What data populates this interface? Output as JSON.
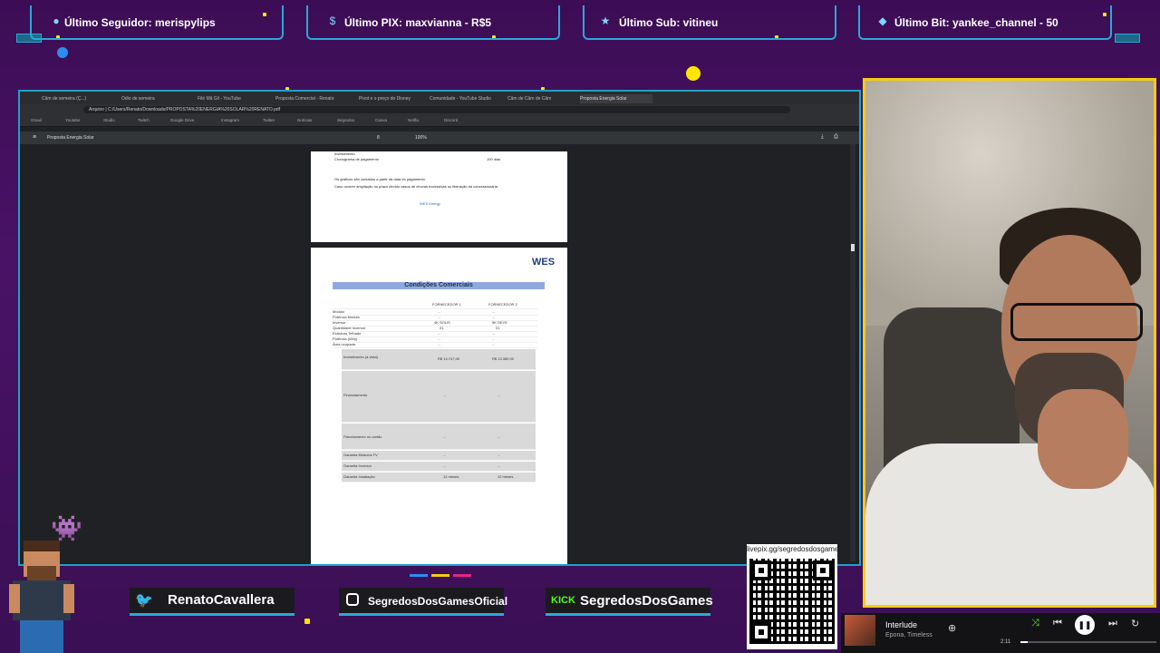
{
  "overlay": {
    "alerts": [
      {
        "label": "Último Seguidor: merispylips",
        "icon": "user-icon"
      },
      {
        "label": "Último PIX: maxvianna - R$5",
        "icon": "dollar-icon"
      },
      {
        "label": "Último Sub: vitineu",
        "icon": "star-icon"
      },
      {
        "label": "Último Bit: yankee_channel - 50",
        "icon": "diamond-icon"
      }
    ],
    "socials": {
      "twitter": "RenatoCavallera",
      "instagram": "SegredosDosGamesOficial",
      "kick_badge": "KICK",
      "kick": "SegredosDosGames"
    },
    "qr_url": "livepix.gg/segredosdosgames",
    "accent": "#2aa8d8",
    "cam_border": "#f4cc14"
  },
  "browser": {
    "tabs": [
      "Câm de semeira (Ç...)",
      "Odio de semeira",
      "Filé Mã Gil - YouTube",
      "Proposta Comercial - Renato",
      "Pivot e o preço do Disney",
      "Comunidade - YouTube Studio",
      "Câm de Câm de Câm",
      "Proposta Energia Solar"
    ],
    "address_label": "Arquivo",
    "address": "C:/Users/Renato/Downloads/PROPOSTA%20ENERGIA%20SOLAR%20RENATO.pdf",
    "bookmarks": [
      "Gmail",
      "Youtube",
      "Studio",
      "Twitch",
      "Google Drive",
      "Instagram",
      "Twitter",
      "Notícias",
      "Segredos",
      "Canva",
      "Netflix",
      "Discord"
    ],
    "pdf_title": "Proposta Energia Solar",
    "pdf_page": "8",
    "pdf_zoom": "100%"
  },
  "pdf": {
    "top_page_lines": [
      "Investimento",
      "Cronograma de pagamento",
      "100 dias",
      "Os gráficos são contados a partir da data do pagamento.",
      "Caso ocorrer ampliação no prazo devido casos de chuvas excessivas ou liberação da concessionária.",
      "WES Energy"
    ],
    "logo": "WES",
    "header": "Condições Comerciais",
    "columns": [
      "",
      "FORNECEDOR 1",
      "FORNECEDOR 2"
    ],
    "rows": [
      [
        "Módulo",
        "...",
        "..."
      ],
      [
        "Potência Módulo",
        "...",
        "..."
      ],
      [
        "Inversor",
        "4K SOLIS",
        "5K DEYE"
      ],
      [
        "Quantidade Inversor",
        "01",
        "01"
      ],
      [
        "Estrutura Telhado",
        "...",
        "..."
      ],
      [
        "Potência (kWp)",
        "...",
        "..."
      ],
      [
        "Área ocupada",
        "...",
        "..."
      ],
      [
        "Investimento (à vista)",
        "R$ 14.747,00",
        "R$ 13.389,00"
      ],
      [
        "Financiamento",
        "...",
        "..."
      ],
      [
        "Parcelamento no cartão",
        "...",
        "..."
      ],
      [
        "Garantia Módulos FV",
        "...",
        "..."
      ],
      [
        "Garantia Inversor",
        "...",
        "..."
      ],
      [
        "Garantia Instalação",
        "12 meses",
        "12 meses"
      ]
    ]
  },
  "player": {
    "title": "Interlude",
    "artist": "Epona, Timeless",
    "time": "2:11",
    "progress": 0.05
  }
}
